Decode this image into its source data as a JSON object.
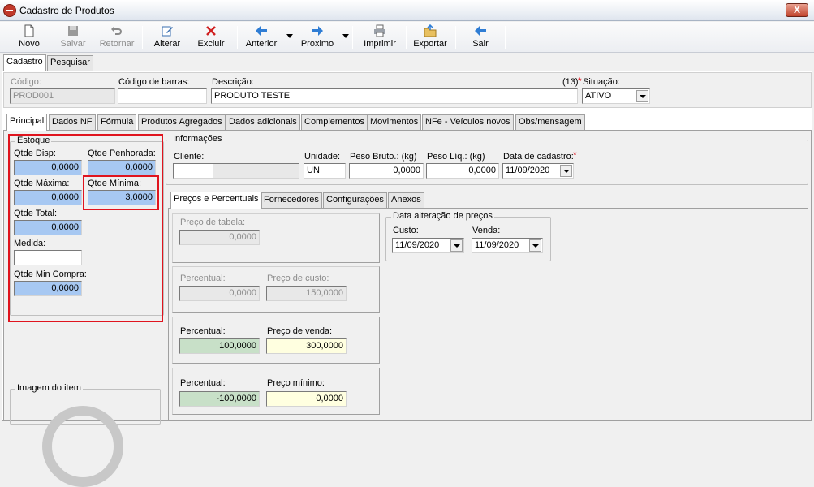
{
  "window": {
    "title": "Cadastro de Produtos",
    "close_label": "X"
  },
  "toolbar": {
    "novo": "Novo",
    "salvar": "Salvar",
    "retornar": "Retornar",
    "alterar": "Alterar",
    "excluir": "Excluir",
    "anterior": "Anterior",
    "proximo": "Proximo",
    "imprimir": "Imprimir",
    "exportar": "Exportar",
    "sair": "Sair"
  },
  "top_tabs": [
    "Cadastro",
    "Pesquisar"
  ],
  "header": {
    "codigo_label": "Código:",
    "codigo_value": "PROD001",
    "barras_label": "Código de barras:",
    "barras_value": "",
    "descricao_label": "Descrição:",
    "descricao_count": "(13)",
    "descricao_value": "PRODUTO TESTE",
    "situacao_label": "Situação:",
    "situacao_value": "ATIVO"
  },
  "main_tabs": [
    "Principal",
    "Dados NF",
    "Fórmula",
    "Produtos Agregados",
    "Dados adicionais",
    "Complementos",
    "Movimentos",
    "NFe - Veículos novos",
    "Obs/mensagem"
  ],
  "estoque": {
    "title": "Estoque",
    "qtde_disp_label": "Qtde Disp:",
    "qtde_disp": "0,0000",
    "qtde_penhorada_label": "Qtde Penhorada:",
    "qtde_penhorada": "0,0000",
    "qtde_maxima_label": "Qtde Máxima:",
    "qtde_maxima": "0,0000",
    "qtde_minima_label": "Qtde Mínima:",
    "qtde_minima": "3,0000",
    "qtde_total_label": "Qtde Total:",
    "qtde_total": "0,0000",
    "medida_label": "Medida:",
    "medida": "",
    "qtde_min_compra_label": "Qtde Min Compra:",
    "qtde_min_compra": "0,0000"
  },
  "imagem": {
    "title": "Imagem do item"
  },
  "informacoes": {
    "title": "Informações",
    "cliente_label": "Cliente:",
    "cliente_code": "",
    "cliente_name": "",
    "unidade_label": "Unidade:",
    "unidade": "UN",
    "peso_bruto_label": "Peso Bruto.: (kg)",
    "peso_bruto": "0,0000",
    "peso_liq_label": "Peso Líq.: (kg)",
    "peso_liq": "0,0000",
    "data_cadastro_label": "Data de cadastro:",
    "data_cadastro": "11/09/2020"
  },
  "sub_tabs": [
    "Preços e Percentuais",
    "Fornecedores",
    "Configurações",
    "Anexos"
  ],
  "precos": {
    "preco_tabela_label": "Preço de tabela:",
    "preco_tabela": "0,0000",
    "percentual_custo_label": "Percentual:",
    "percentual_custo": "0,0000",
    "preco_custo_label": "Preço de custo:",
    "preco_custo": "150,0000",
    "percentual_venda_label": "Percentual:",
    "percentual_venda": "100,0000",
    "preco_venda_label": "Preço de venda:",
    "preco_venda": "300,0000",
    "percentual_minimo_label": "Percentual:",
    "percentual_minimo": "-100,0000",
    "preco_minimo_label": "Preço mínimo:",
    "preco_minimo": "0,0000"
  },
  "data_alteracao": {
    "title": "Data alteração de preços",
    "custo_label": "Custo:",
    "custo": "11/09/2020",
    "venda_label": "Venda:",
    "venda": "11/09/2020"
  },
  "colors": {
    "highlight": "#e0141e",
    "blue_field": "#a7c8f2",
    "green_field": "#c8e0c8",
    "yellow_field": "#ffffe0"
  }
}
